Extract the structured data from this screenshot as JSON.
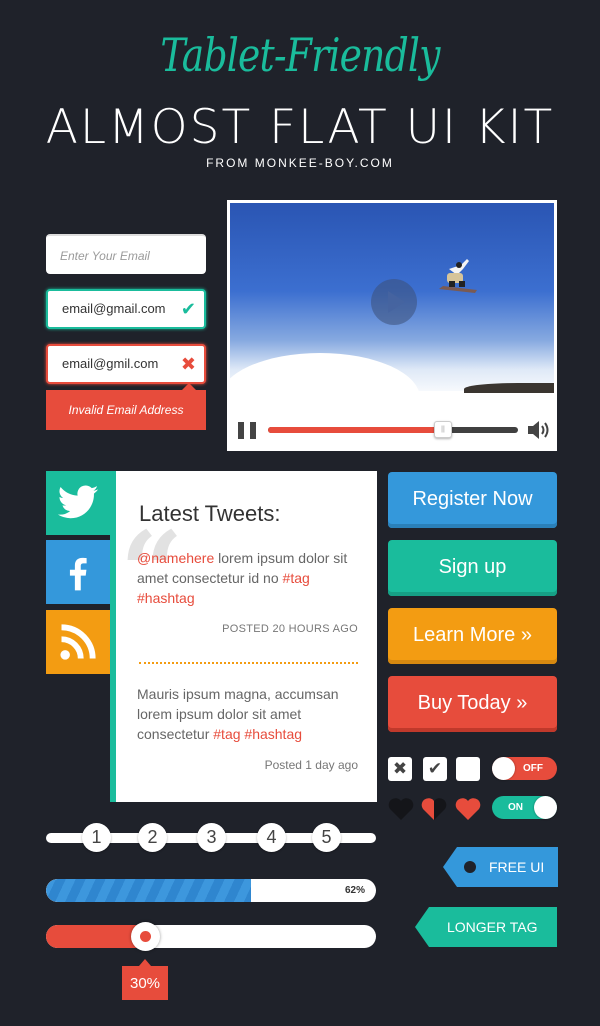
{
  "header": {
    "script_title": "Tablet-Friendly",
    "title": "ALMOST FLAT UI KIT",
    "subtitle": "FROM MONKEE-BOY.COM"
  },
  "email_fields": [
    {
      "state": "empty",
      "value": "",
      "placeholder": "Enter Your Email",
      "icon": ""
    },
    {
      "state": "valid",
      "value": "email@gmail.com",
      "icon": "✔"
    },
    {
      "state": "invalid",
      "value": "email@gmil.com",
      "icon": "✖"
    }
  ],
  "email_error": "Invalid Email Address",
  "video_player": {
    "progress_percent": 70,
    "play_icon": "play-icon",
    "pause_icon": "pause-icon",
    "volume_icon": "volume-icon",
    "knob_glyph": "||"
  },
  "social": [
    {
      "name": "twitter",
      "color": "#1abc9c"
    },
    {
      "name": "facebook",
      "color": "#3498db",
      "glyph": "f"
    },
    {
      "name": "rss",
      "color": "#f39c12"
    }
  ],
  "tweets": {
    "title": "Latest Tweets:",
    "quote_glyph": "“",
    "items": [
      {
        "mention": "@namehere",
        "text": " lorem ipsum dolor sit amet consectetur id no ",
        "tag1": "#tag",
        "tag2": "#hashtag",
        "posted": "POSTED 20 HOURS AGO"
      },
      {
        "text": "Mauris ipsum magna, accumsan lorem ipsum dolor sit amet consectetur ",
        "tag1": "#tag",
        "tag2": "#hashtag",
        "posted": "Posted 1 day ago"
      }
    ]
  },
  "buttons": {
    "register": "Register Now",
    "signup": "Sign up",
    "learn_more": "Learn More »",
    "buy_today": "Buy Today »"
  },
  "checkboxes": [
    {
      "state": "x",
      "glyph": "✖"
    },
    {
      "state": "checked",
      "glyph": "✔"
    },
    {
      "state": "empty",
      "glyph": ""
    }
  ],
  "toggles": {
    "off_label": "OFF",
    "on_label": "ON"
  },
  "hearts": [
    "empty",
    "half",
    "full"
  ],
  "tags": {
    "free_ui": "FREE UI",
    "longer_tag": "LONGER TAG"
  },
  "pagination": {
    "pages": [
      "1",
      "2",
      "3",
      "4",
      "5"
    ],
    "active": "2"
  },
  "progress": {
    "value": 62,
    "label": "62%"
  },
  "slider": {
    "value": 30,
    "label": "30%"
  },
  "colors": {
    "background": "#1f222a",
    "teal": "#1abc9c",
    "blue": "#3498db",
    "orange": "#f39c12",
    "red": "#e74c3c"
  }
}
